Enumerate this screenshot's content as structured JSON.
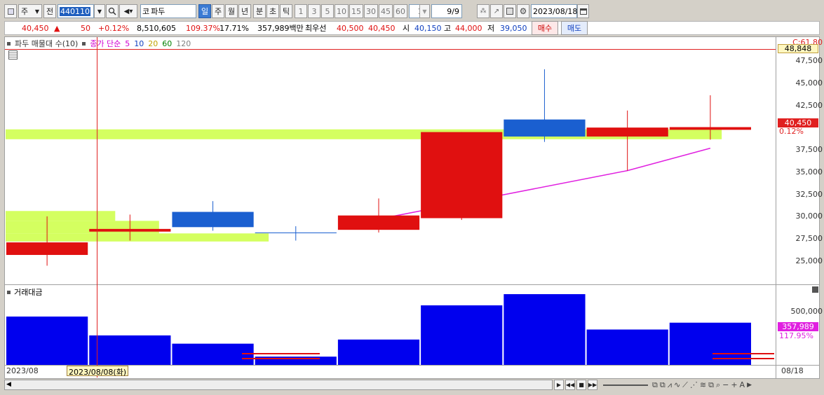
{
  "toolbar": {
    "market": "주",
    "market_mode": "전",
    "code": "440110",
    "type_prefix": "코",
    "name": "파두",
    "periods": [
      "일",
      "주",
      "월",
      "년",
      "분",
      "초",
      "틱"
    ],
    "active_period": "일",
    "minutes": [
      "1",
      "3",
      "5",
      "10",
      "15",
      "30",
      "45",
      "60"
    ],
    "unit": "1",
    "count": "9/9",
    "date": "2023/08/18"
  },
  "quote": {
    "price": "40,450",
    "arrow": "▲",
    "change": "50",
    "rate": "+0.12%",
    "volume": "8,510,605",
    "vol_ratio": "109.37%",
    "turnover": "17.71%",
    "amount": "357,989백만",
    "bid_label": "최우선",
    "bid1": "40,500",
    "bid2": "40,450",
    "open_label": "시",
    "open": "40,150",
    "high_label": "고",
    "high": "44,000",
    "low_label": "저",
    "low": "39,050",
    "buy": "매수",
    "sell": "매도"
  },
  "price_panel": {
    "legend_name": "파두 매물대 수(10)",
    "ma_label": "종가 단순",
    "ma_periods": [
      "5",
      "10",
      "20",
      "60",
      "120"
    ],
    "ma_colors": [
      "#d000d0",
      "#1040c0",
      "#c0a000",
      "#008000",
      "#808080"
    ],
    "top_label": "C:61.80",
    "high_tag": "48,848",
    "price_tag": "40,450",
    "pct_tag": "0.12%",
    "y_labels": [
      "47,500",
      "45,000",
      "42,500",
      "40,000",
      "37,500",
      "35,000",
      "32,500",
      "30,000",
      "27,500",
      "25,000"
    ]
  },
  "volume_panel": {
    "legend": "거래대금",
    "y_label": "500,000",
    "value_tag": "357,989",
    "pct_tag": "117.95%"
  },
  "xaxis": {
    "start": "2023/08",
    "cursor": "2023/08/08(화)",
    "end": "08/18"
  },
  "chart_data": {
    "type": "candlestick",
    "candles": [
      {
        "o": 26200,
        "c": 27600,
        "h": 30500,
        "l": 25000,
        "dir": "up"
      },
      {
        "o": 28800,
        "c": 29100,
        "h": 30700,
        "l": 27800,
        "dir": "up"
      },
      {
        "o": 31000,
        "c": 29300,
        "h": 32200,
        "l": 28900,
        "dir": "down"
      },
      {
        "o": 28700,
        "c": 28700,
        "h": 29400,
        "l": 27800,
        "dir": "flat"
      },
      {
        "o": 29000,
        "c": 30600,
        "h": 32500,
        "l": 28700,
        "dir": "up"
      },
      {
        "o": 30300,
        "c": 39900,
        "h": 39900,
        "l": 30100,
        "dir": "up"
      },
      {
        "o": 41300,
        "c": 39400,
        "h": 46900,
        "l": 38800,
        "dir": "down"
      },
      {
        "o": 39400,
        "c": 40400,
        "h": 42300,
        "l": 35600,
        "dir": "up"
      },
      {
        "o": 40150,
        "c": 40450,
        "h": 44000,
        "l": 39050,
        "dir": "up"
      }
    ],
    "ma5": [
      null,
      null,
      null,
      null,
      30200,
      null,
      null,
      35600,
      38100
    ],
    "vol_profile": [
      {
        "lo": 39100,
        "hi": 40200,
        "len": 0.98
      },
      {
        "lo": 30000,
        "hi": 31100,
        "len": 0.15
      },
      {
        "lo": 28600,
        "hi": 30000,
        "len": 0.21
      },
      {
        "lo": 27700,
        "hi": 28600,
        "len": 0.36
      }
    ],
    "amounts": [
      410000,
      250000,
      180000,
      70000,
      215000,
      505000,
      600000,
      300000,
      357989
    ],
    "ylim": [
      23000,
      49000
    ],
    "vlim": [
      0,
      600000
    ]
  }
}
